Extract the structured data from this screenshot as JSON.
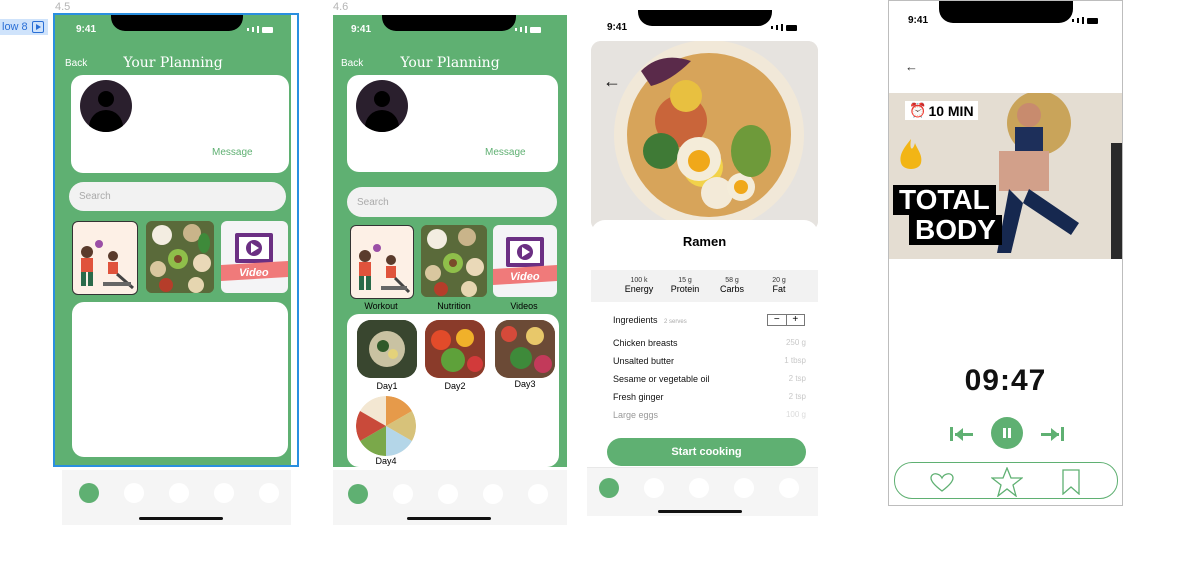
{
  "canvas": {
    "frame1_label": "4.5",
    "frame2_label": "4.6",
    "flow_tag": "low 8"
  },
  "status": {
    "time": "9:41"
  },
  "planning": {
    "back": "Back",
    "title": "Your Planning",
    "message": "Message",
    "search_placeholder": "Search",
    "video_badge": "Video",
    "categories": [
      "Workout",
      "Nutrition",
      "Videos"
    ],
    "days": [
      "Day1",
      "Day2",
      "Day3",
      "Day4"
    ]
  },
  "recipe": {
    "title": "Ramen",
    "nutrition": [
      {
        "value": "100 k",
        "label": "Energy"
      },
      {
        "value": "15 g",
        "label": "Protein"
      },
      {
        "value": "58 g",
        "label": "Carbs"
      },
      {
        "value": "20 g",
        "label": "Fat"
      }
    ],
    "ingredients_label": "Ingredients",
    "serves": "2 serves",
    "ingredients": [
      {
        "name": "Chicken breasts",
        "amount": "250 g"
      },
      {
        "name": "Unsalted butter",
        "amount": "1 tbsp"
      },
      {
        "name": "Sesame or vegetable oil",
        "amount": "2 tsp"
      },
      {
        "name": "Fresh ginger",
        "amount": "2 tsp"
      },
      {
        "name": "Large eggs",
        "amount": "100 g"
      }
    ],
    "cta": "Start cooking",
    "minus": "−",
    "plus": "+"
  },
  "workout": {
    "duration_badge": "10 MIN",
    "banner_line1": "TOTAL",
    "banner_line2": "BODY",
    "timer": "09:47"
  },
  "colors": {
    "accent": "#5fb072",
    "selection": "#2a8fe0"
  }
}
